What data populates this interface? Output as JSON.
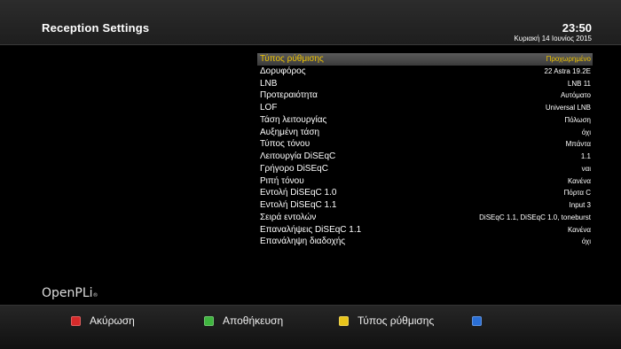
{
  "header": {
    "title": "Reception Settings",
    "time": "23:50",
    "date": "Κυριακή 14 Ιουνίος 2015"
  },
  "settings": [
    {
      "label": "Τύπος ρύθμισης",
      "value": "Προχωρημένο",
      "selected": true
    },
    {
      "label": "Δορυφόρος",
      "value": "22 Astra 19.2E"
    },
    {
      "label": "LNB",
      "value": "LNB 11"
    },
    {
      "label": "Προτεραιότητα",
      "value": "Αυτόματο"
    },
    {
      "label": "LOF",
      "value": "Universal LNB"
    },
    {
      "label": "Τάση λειτουργίας",
      "value": "Πόλωση"
    },
    {
      "label": "Αυξημένη τάση",
      "value": "όχι"
    },
    {
      "label": "Τύπος τόνου",
      "value": "Μπάντα"
    },
    {
      "label": "Λειτουργία DiSEqC",
      "value": "1.1"
    },
    {
      "label": "Γρήγορο DiSEqC",
      "value": "ναι"
    },
    {
      "label": "Ριπή τόνου",
      "value": "Κανένα"
    },
    {
      "label": "Εντολή DiSEqC 1.0",
      "value": "Πόρτα C"
    },
    {
      "label": "Εντολή DiSEqC 1.1",
      "value": "Input 3"
    },
    {
      "label": "Σειρά εντολών",
      "value": "DiSEqC 1.1, DiSEqC 1.0, toneburst"
    },
    {
      "label": "Επαναλήψεις DiSEqC 1.1",
      "value": "Κανένα"
    },
    {
      "label": "Επανάληψη διαδοχής",
      "value": "όχι"
    }
  ],
  "logo": {
    "text": "OpenPLi",
    "suffix": "®"
  },
  "footer": {
    "red_label": "Ακύρωση",
    "green_label": "Αποθήκευση",
    "yellow_label": "Τύπος ρύθμισης",
    "blue_label": ""
  },
  "colors": {
    "selected_text": "#f0c400",
    "red": "#d62a2a",
    "green": "#3fb53f",
    "yellow": "#e8c41a",
    "blue": "#2a6fd6"
  }
}
